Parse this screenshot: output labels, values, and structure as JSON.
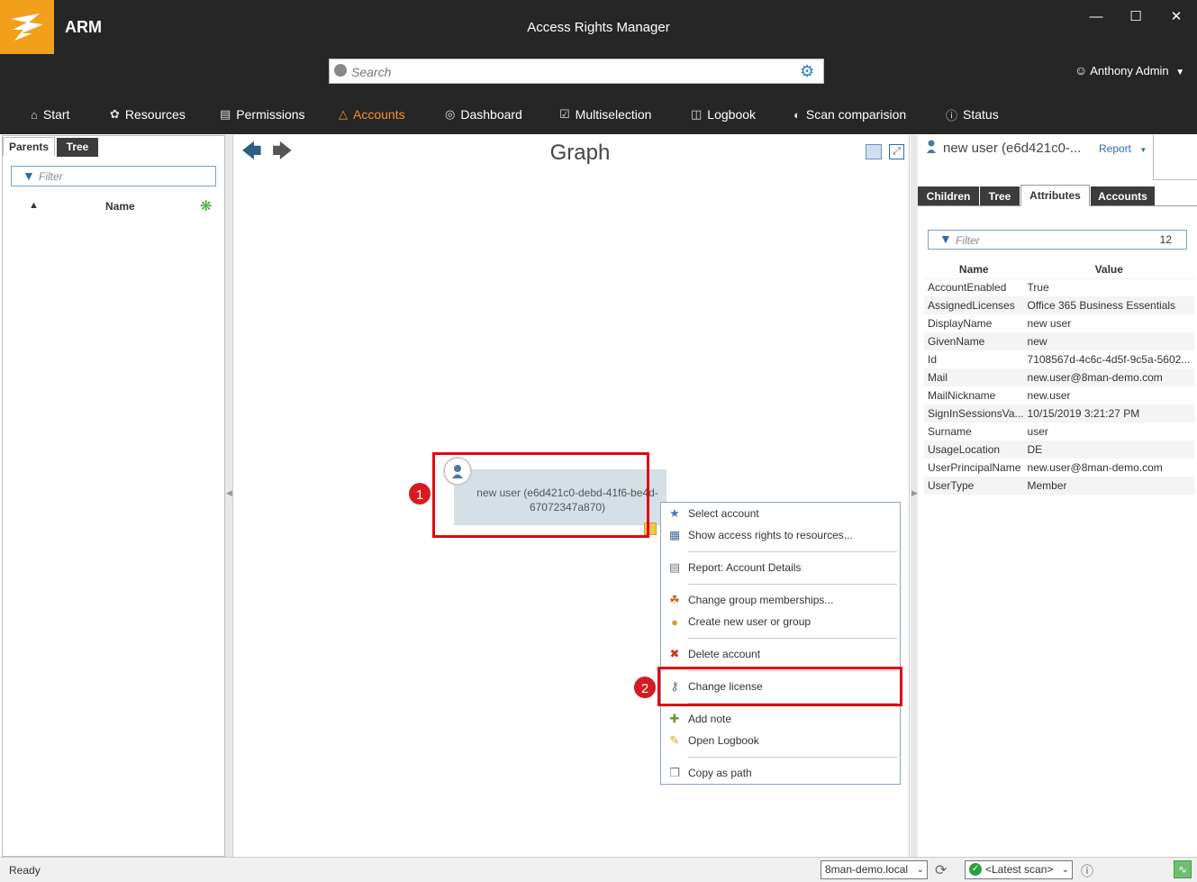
{
  "app": {
    "short_name": "ARM",
    "window_title": "Access Rights Manager"
  },
  "search": {
    "placeholder": "Search"
  },
  "user": {
    "name": "Anthony Admin"
  },
  "nav": {
    "items": [
      {
        "label": "Start",
        "icon": "home-icon"
      },
      {
        "label": "Resources",
        "icon": "resources-icon"
      },
      {
        "label": "Permissions",
        "icon": "permissions-icon"
      },
      {
        "label": "Accounts",
        "icon": "accounts-icon",
        "active": true
      },
      {
        "label": "Dashboard",
        "icon": "dashboard-icon"
      },
      {
        "label": "Multiselection",
        "icon": "multiselection-icon"
      },
      {
        "label": "Logbook",
        "icon": "logbook-icon"
      },
      {
        "label": "Scan comparision",
        "icon": "scan-comparison-icon"
      },
      {
        "label": "Status",
        "icon": "status-icon"
      }
    ]
  },
  "left_panel": {
    "tabs": [
      "Parents",
      "Tree"
    ],
    "filter_placeholder": "Filter",
    "column_name": "Name"
  },
  "graph": {
    "title": "Graph",
    "node_label": "new user (e6d421c0-debd-41f6-be4d-67072347a870)"
  },
  "annotations": {
    "badge1": "1",
    "badge2": "2"
  },
  "context_menu": {
    "items": [
      "Select account",
      "Show access rights to resources...",
      "Report: Account Details",
      "Change group memberships...",
      "Create new user or group",
      "Delete account",
      "Change license",
      "Add note",
      "Open Logbook",
      "Copy as path"
    ]
  },
  "right_panel": {
    "title": "new user (e6d421c0-...",
    "report_label": "Report",
    "tabs": [
      "Children",
      "Tree",
      "Attributes",
      "Accounts"
    ],
    "active_tab": "Attributes",
    "filter_placeholder": "Filter",
    "filter_count": "12",
    "columns": {
      "name": "Name",
      "value": "Value"
    },
    "rows": [
      {
        "name": "AccountEnabled",
        "value": "True"
      },
      {
        "name": "AssignedLicenses",
        "value": "Office 365 Business Essentials"
      },
      {
        "name": "DisplayName",
        "value": "new user"
      },
      {
        "name": "GivenName",
        "value": "new"
      },
      {
        "name": "Id",
        "value": "7108567d-4c6c-4d5f-9c5a-5602..."
      },
      {
        "name": "Mail",
        "value": "new.user@8man-demo.com"
      },
      {
        "name": "MailNickname",
        "value": "new.user"
      },
      {
        "name": "SignInSessionsVa...",
        "value": "10/15/2019 3:21:27 PM"
      },
      {
        "name": "Surname",
        "value": "user"
      },
      {
        "name": "UsageLocation",
        "value": "DE"
      },
      {
        "name": "UserPrincipalName",
        "value": "new.user@8man-demo.com"
      },
      {
        "name": "UserType",
        "value": "Member"
      }
    ]
  },
  "status_bar": {
    "status": "Ready",
    "domain": "8man-demo.local",
    "scan": "<Latest scan>"
  },
  "colors": {
    "accent": "#f39325",
    "titlebar": "#262626",
    "highlight": "#e30613"
  }
}
